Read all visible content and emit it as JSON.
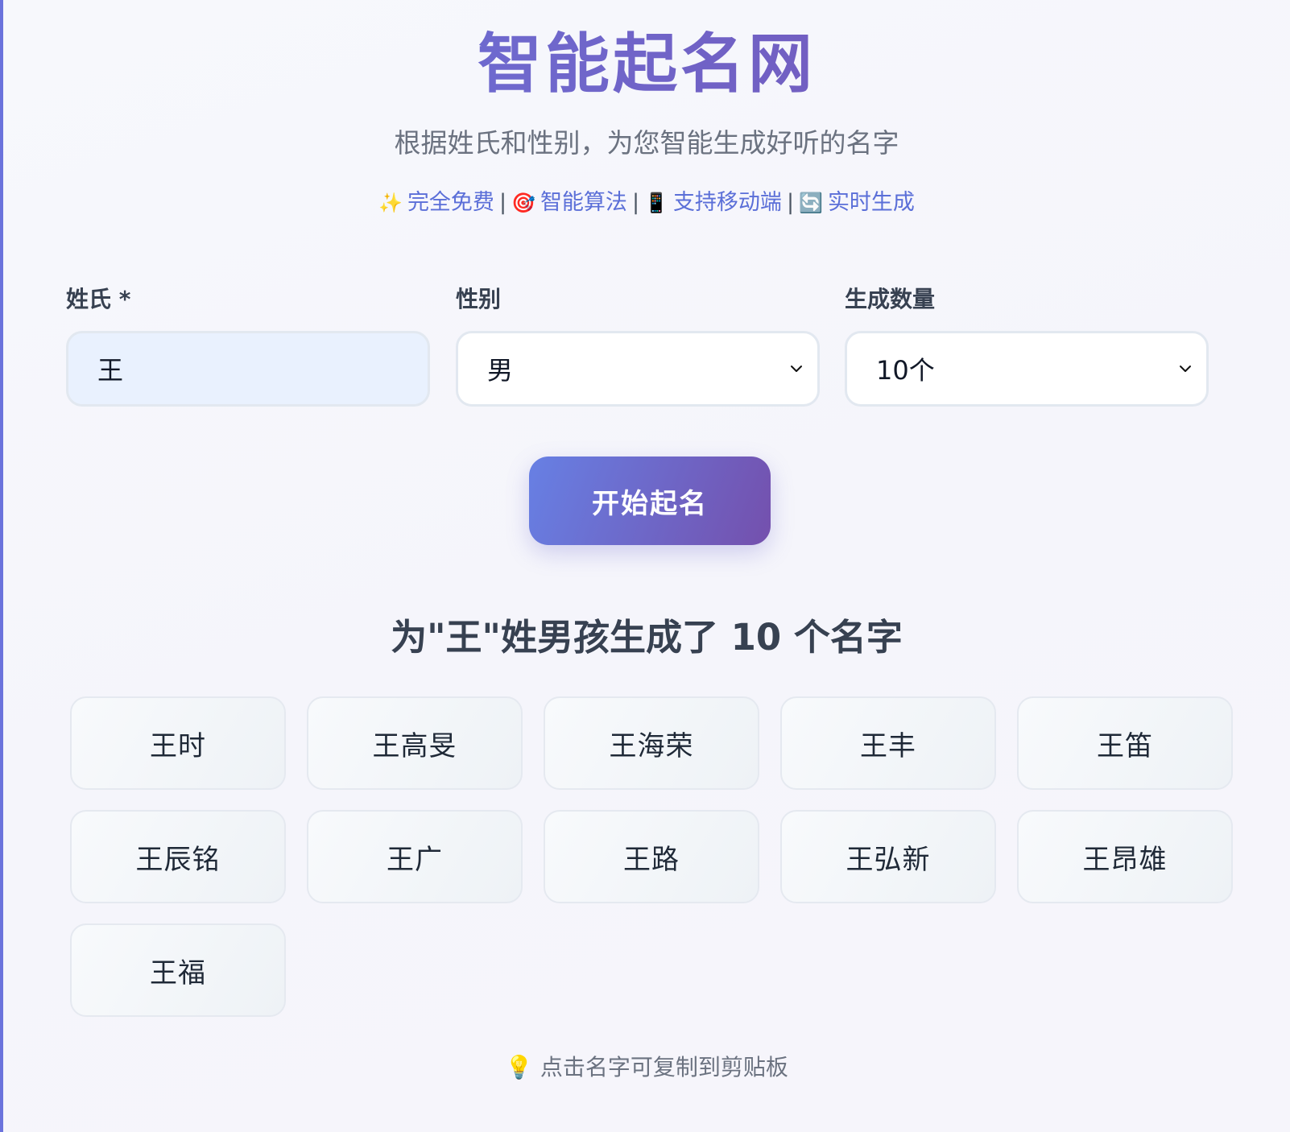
{
  "header": {
    "title": "智能起名网",
    "subtitle": "根据姓氏和性别，为您智能生成好听的名字",
    "features": [
      {
        "emoji": "✨",
        "label": "完全免费"
      },
      {
        "emoji": "🎯",
        "label": "智能算法"
      },
      {
        "emoji": "📱",
        "label": "支持移动端"
      },
      {
        "emoji": "🔄",
        "label": "实时生成"
      }
    ],
    "separator": "|"
  },
  "form": {
    "surname": {
      "label": "姓氏 *",
      "value": "王"
    },
    "gender": {
      "label": "性别",
      "value": "男"
    },
    "count": {
      "label": "生成数量",
      "value": "10个"
    },
    "submit_label": "开始起名"
  },
  "results": {
    "title": "为\"王\"姓男孩生成了 10 个名字",
    "names": [
      "王时",
      "王高旻",
      "王海荣",
      "王丰",
      "王笛",
      "王辰铭",
      "王广",
      "王路",
      "王弘新",
      "王昂雄",
      "王福"
    ]
  },
  "tip": {
    "emoji": "💡",
    "text": "点击名字可复制到剪贴板"
  },
  "colors": {
    "accent_start": "#6780e4",
    "accent_end": "#7450ad",
    "feature_link": "#5b6fd8",
    "input_bg": "#e9f1fe"
  }
}
